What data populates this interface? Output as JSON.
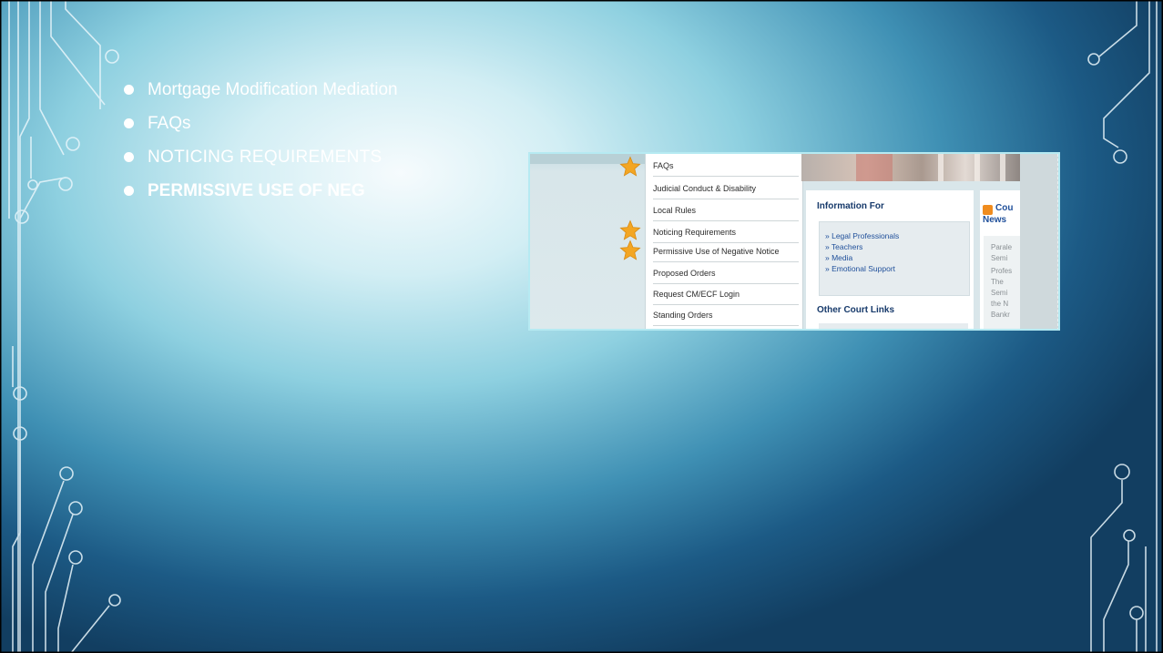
{
  "slide": {
    "bullets": [
      "Mortgage Modification Mediation",
      "FAQs",
      "NOTICING REQUIREMENTS",
      "PERMISSIVE USE OF NEG"
    ]
  },
  "screenshot": {
    "menu_items": [
      "FAQs",
      "Judicial Conduct & Disability",
      "Local Rules",
      "Noticing Requirements",
      "Permissive Use of Negative Notice",
      "Proposed Orders",
      "Request CM/ECF Login",
      "Standing Orders"
    ],
    "info_heading": "Information For",
    "info_links": [
      "» Legal Professionals",
      "» Teachers",
      "» Media",
      "» Emotional Support"
    ],
    "other_heading": "Other Court Links",
    "news_heading_1": "Cou",
    "news_heading_2": "News",
    "news_lines": [
      "Parale",
      "Semi",
      "Profes",
      "The ",
      "Semi",
      "the N",
      "Bankr"
    ]
  },
  "colors": {
    "star": "#f3a623",
    "link": "#1f4f9a",
    "heading": "#173a6b"
  },
  "icons": {
    "star": "star-icon",
    "rss": "rss-icon"
  }
}
